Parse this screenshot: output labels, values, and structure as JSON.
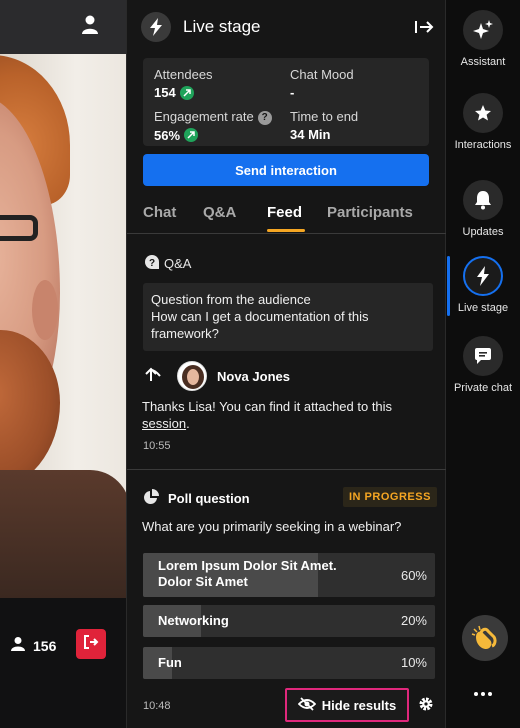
{
  "video": {
    "viewer_count": "156"
  },
  "panel": {
    "title": "Live stage",
    "stats": {
      "attendees_label": "Attendees",
      "attendees_value": "154",
      "chat_mood_label": "Chat Mood",
      "chat_mood_value": "-",
      "engagement_label": "Engagement rate",
      "engagement_value": "56%",
      "time_label": "Time to end",
      "time_value": "34 Min"
    },
    "send_button": "Send interaction",
    "tabs": [
      {
        "label": "Chat"
      },
      {
        "label": "Q&A"
      },
      {
        "label": "Feed"
      },
      {
        "label": "Participants"
      }
    ],
    "active_tab": "Feed",
    "qa": {
      "section_label": "Q&A",
      "question_line1": "Question from the audience",
      "question_line2": "How can I get a documentation of this framework?",
      "reply_author": "Nova Jones",
      "reply_text_main": "Thanks Lisa! You can find it attached to this ",
      "reply_text_link": "session",
      "reply_text_end": ".",
      "reply_time": "10:55"
    },
    "poll": {
      "label": "Poll question",
      "status": "IN PROGRESS",
      "question": "What are you primarily seeking in a webinar?",
      "options": [
        {
          "label_line1": "Lorem Ipsum Dolor Sit Amet.",
          "label_line2": "Dolor Sit Amet",
          "percent_label": "60%",
          "fraction": 0.6
        },
        {
          "label_line1": "Networking",
          "percent_label": "20%",
          "fraction": 0.2
        },
        {
          "label_line1": "Fun",
          "percent_label": "10%",
          "fraction": 0.1
        }
      ],
      "time": "10:48",
      "hide_results_label": "Hide results"
    }
  },
  "rail": {
    "items": [
      {
        "label": "Assistant",
        "icon": "sparkles-icon"
      },
      {
        "label": "Interactions",
        "icon": "star-icon"
      },
      {
        "label": "Updates",
        "icon": "bell-icon"
      },
      {
        "label": "Live stage",
        "icon": "bolt-icon"
      },
      {
        "label": "Private chat",
        "icon": "chat-bubble-icon"
      }
    ],
    "active": "Live stage"
  },
  "colors": {
    "accent_blue": "#1570ef",
    "accent_orange": "#f5a623",
    "danger_red": "#e0233a",
    "highlight_pink": "#e0287c",
    "trend_green": "#1fa35a"
  }
}
